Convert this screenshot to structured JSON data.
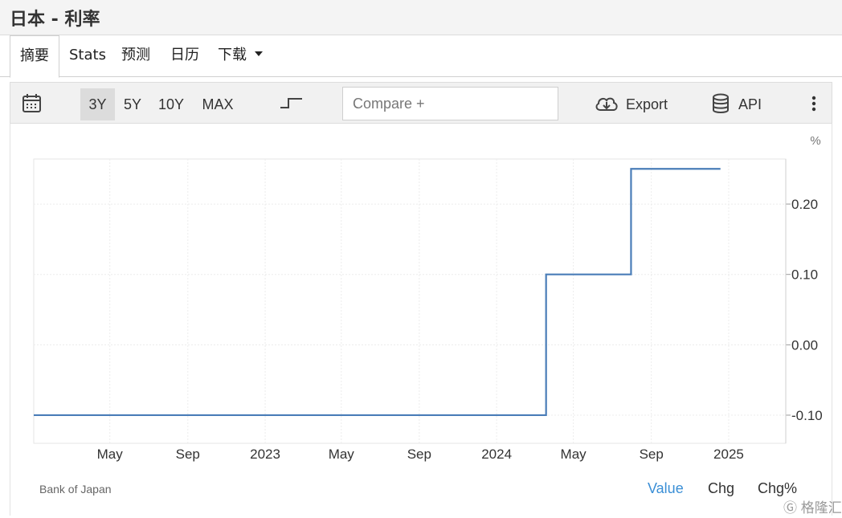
{
  "page_title": "日本 - 利率",
  "tabs": [
    {
      "label": "摘要",
      "active": true
    },
    {
      "label": "Stats",
      "active": false
    },
    {
      "label": "预测",
      "active": false
    },
    {
      "label": "日历",
      "active": false
    },
    {
      "label": "下载",
      "active": false,
      "dropdown": true
    }
  ],
  "toolbar": {
    "ranges": [
      "3Y",
      "5Y",
      "10Y",
      "MAX"
    ],
    "active_range": "3Y",
    "compare_placeholder": "Compare +",
    "export_label": "Export",
    "api_label": "API"
  },
  "chart_data": {
    "type": "line",
    "step": true,
    "unit_label": "%",
    "x_ticks": [
      "May",
      "Sep",
      "2023",
      "May",
      "Sep",
      "2024",
      "May",
      "Sep",
      "2025"
    ],
    "y_ticks": [
      "0.20",
      "0.10",
      "0.00",
      "-0.10"
    ],
    "ylim": [
      -0.1,
      0.25
    ],
    "grid": true,
    "series": [
      {
        "color": "#4a7db8",
        "points": [
          {
            "x": "2022-01-01",
            "y": -0.1
          },
          {
            "x": "2024-03-19",
            "y": 0.1
          },
          {
            "x": "2024-07-31",
            "y": 0.25
          },
          {
            "x": "2024-12-19",
            "y": 0.25
          }
        ]
      }
    ]
  },
  "footer": {
    "source": "Bank of Japan",
    "views": [
      "Value",
      "Chg",
      "Chg%"
    ],
    "active_view": "Value",
    "watermark": "格隆汇"
  }
}
